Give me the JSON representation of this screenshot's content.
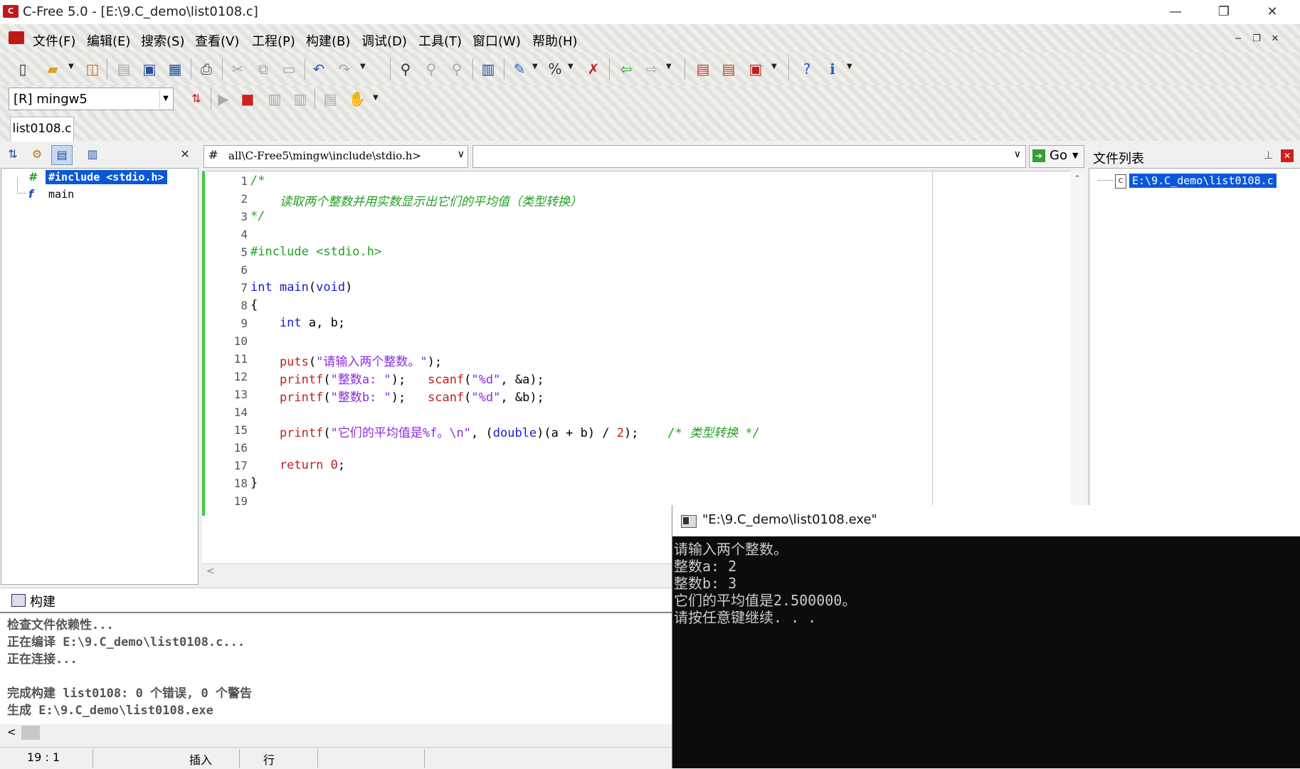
{
  "window": {
    "title": "C-Free 5.0 - [E:\\9.C_demo\\list0108.c]",
    "app_icon": "C",
    "minimize": "—",
    "maximize": "❐",
    "close": "✕"
  },
  "menu": {
    "items": [
      "文件(F)",
      "编辑(E)",
      "搜索(S)",
      "查看(V)",
      "工程(P)",
      "构建(B)",
      "调试(D)",
      "工具(T)",
      "窗口(W)",
      "帮助(H)"
    ],
    "mdi_min": "−",
    "mdi_restore": "❐",
    "mdi_close": "✕"
  },
  "toolbar": {
    "compiler": "[R] mingw5"
  },
  "tabs": {
    "file_tab": "list0108.c"
  },
  "left_panel": {
    "close": "✕",
    "tree": [
      {
        "icon": "#",
        "label": "#include <stdio.h>",
        "selected": true
      },
      {
        "icon": "f",
        "label": "main",
        "selected": false
      }
    ]
  },
  "editor": {
    "scope_icon": "#",
    "scope": "all\\C-Free5\\mingw\\include\\stdio.h>",
    "func": "",
    "go_label": "Go",
    "line_numbers": [
      "1",
      "2",
      "3",
      "4",
      "5",
      "6",
      "7",
      "8",
      "9",
      "10",
      "11",
      "12",
      "13",
      "14",
      "15",
      "16",
      "17",
      "18",
      "19"
    ],
    "code": {
      "l1": "/*",
      "l2": "    读取两个整数并用实数显示出它们的平均值（类型转换）",
      "l3": "*/",
      "l5": "#include <stdio.h>",
      "l7_kw": "int",
      "l7_fn": " main",
      "l7_rest1": "(",
      "l7_kw2": "void",
      "l7_rest2": ")",
      "l8": "{",
      "l9_kw": "    int",
      "l9_rest": " a, b;",
      "l11_fn": "    puts",
      "l11_p": "(",
      "l11_str": "\"请输入两个整数。\"",
      "l11_e": ");",
      "l12_fn": "    printf",
      "l12_p": "(",
      "l12_str": "\"整数a: \"",
      "l12_e": ");   ",
      "l12_fn2": "scanf",
      "l12_p2": "(",
      "l12_str2": "\"%d\"",
      "l12_e2": ", &a);",
      "l13_fn": "    printf",
      "l13_p": "(",
      "l13_str": "\"整数b: \"",
      "l13_e": ");   ",
      "l13_fn2": "scanf",
      "l13_p2": "(",
      "l13_str2": "\"%d\"",
      "l13_e2": ", &b);",
      "l15_fn": "    printf",
      "l15_p": "(",
      "l15_str": "\"它们的平均值是%f。\\n\"",
      "l15_m": ", (",
      "l15_kw": "double",
      "l15_m2": ")(a + b) / ",
      "l15_num": "2",
      "l15_e": ");    ",
      "l15_cm": "/* 类型转换 */",
      "l17_kw": "    return",
      "l17_num": " 0",
      "l17_e": ";",
      "l18": "}"
    }
  },
  "right_panel": {
    "title": "文件列表",
    "pin": "⊥",
    "close": "✕",
    "file": "E:\\9.C_demo\\list0108.c"
  },
  "build": {
    "title": "构建",
    "lines": [
      "检查文件依赖性...",
      "正在编译 E:\\9.C_demo\\list0108.c...",
      "正在连接...",
      "",
      "完成构建 list0108: 0 个错误, 0 个警告",
      "生成 E:\\9.C_demo\\list0108.exe"
    ],
    "scroll_left": "<"
  },
  "status": {
    "position": "19 :  1",
    "mode": "插入",
    "line_label": "行"
  },
  "console": {
    "title": "\"E:\\9.C_demo\\list0108.exe\"",
    "lines": [
      "请输入两个整数。",
      "整数a: 2",
      "整数b: 3",
      "它们的平均值是2.500000。",
      "请按任意键继续. . ."
    ]
  }
}
